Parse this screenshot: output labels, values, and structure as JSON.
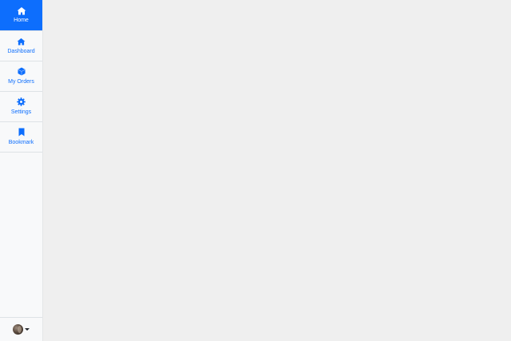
{
  "brand": {
    "label": "Home",
    "icon": "home-icon",
    "color": "#0d6efd"
  },
  "nav": {
    "items": [
      {
        "label": "Dashboard",
        "icon": "home-icon"
      },
      {
        "label": "My Orders",
        "icon": "box-icon"
      },
      {
        "label": "Settings",
        "icon": "gear-icon"
      },
      {
        "label": "Bookmark",
        "icon": "bookmark-icon"
      }
    ]
  },
  "user": {
    "avatar": "avatar-image",
    "menu_icon": "caret-down-icon"
  },
  "colors": {
    "accent": "#0d6efd",
    "sidebar_bg": "#f8f9fa",
    "content_bg": "#efefef"
  }
}
